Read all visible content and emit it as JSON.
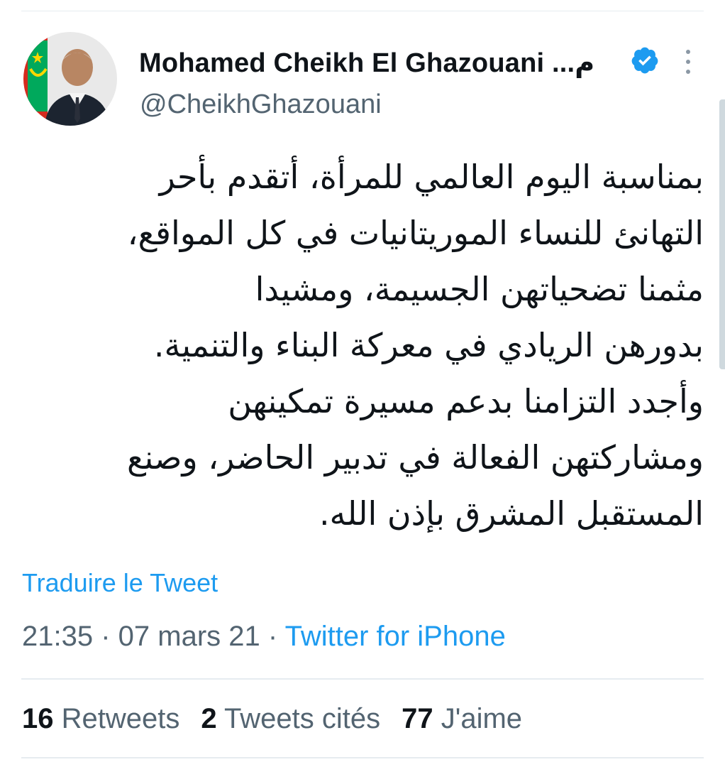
{
  "tweet": {
    "author": {
      "display_name": "Mohamed Cheikh El Ghazouani ...م",
      "handle": "@CheikhGhazouani",
      "verified": true,
      "avatar_icon": "profile-photo-icon",
      "verified_icon": "verified-badge-icon",
      "more_icon": "more-options-icon"
    },
    "text_lines": [
      "بمناسبة  اليوم العالمي للمرأة، أتقدم بأحر",
      "التهانئ للنساء الموريتانيات في كل المواقع،",
      "مثمنا تضحياتهن  الجسيمة، ومشيدا",
      "بدورهن الريادي في معركة البناء والتنمية.",
      "وأجدد التزامنا بدعم مسيرة تمكينهن",
      "ومشاركتهن الفعالة في تدبير الحاضر، وصنع",
      "المستقبل المشرق بإذن الله."
    ],
    "translate_label": "Traduire le Tweet",
    "time": "21:35",
    "date": "07 mars 21",
    "separator": " · ",
    "source": "Twitter for iPhone",
    "stats": {
      "retweets_count": "16",
      "retweets_label": "Retweets",
      "quotes_count": "2",
      "quotes_label": "Tweets cités",
      "likes_count": "77",
      "likes_label": "J'aime"
    }
  },
  "colors": {
    "accent": "#1d9bf0",
    "text": "#0f1419",
    "secondary": "#536471",
    "divider": "#e6ecf0"
  }
}
